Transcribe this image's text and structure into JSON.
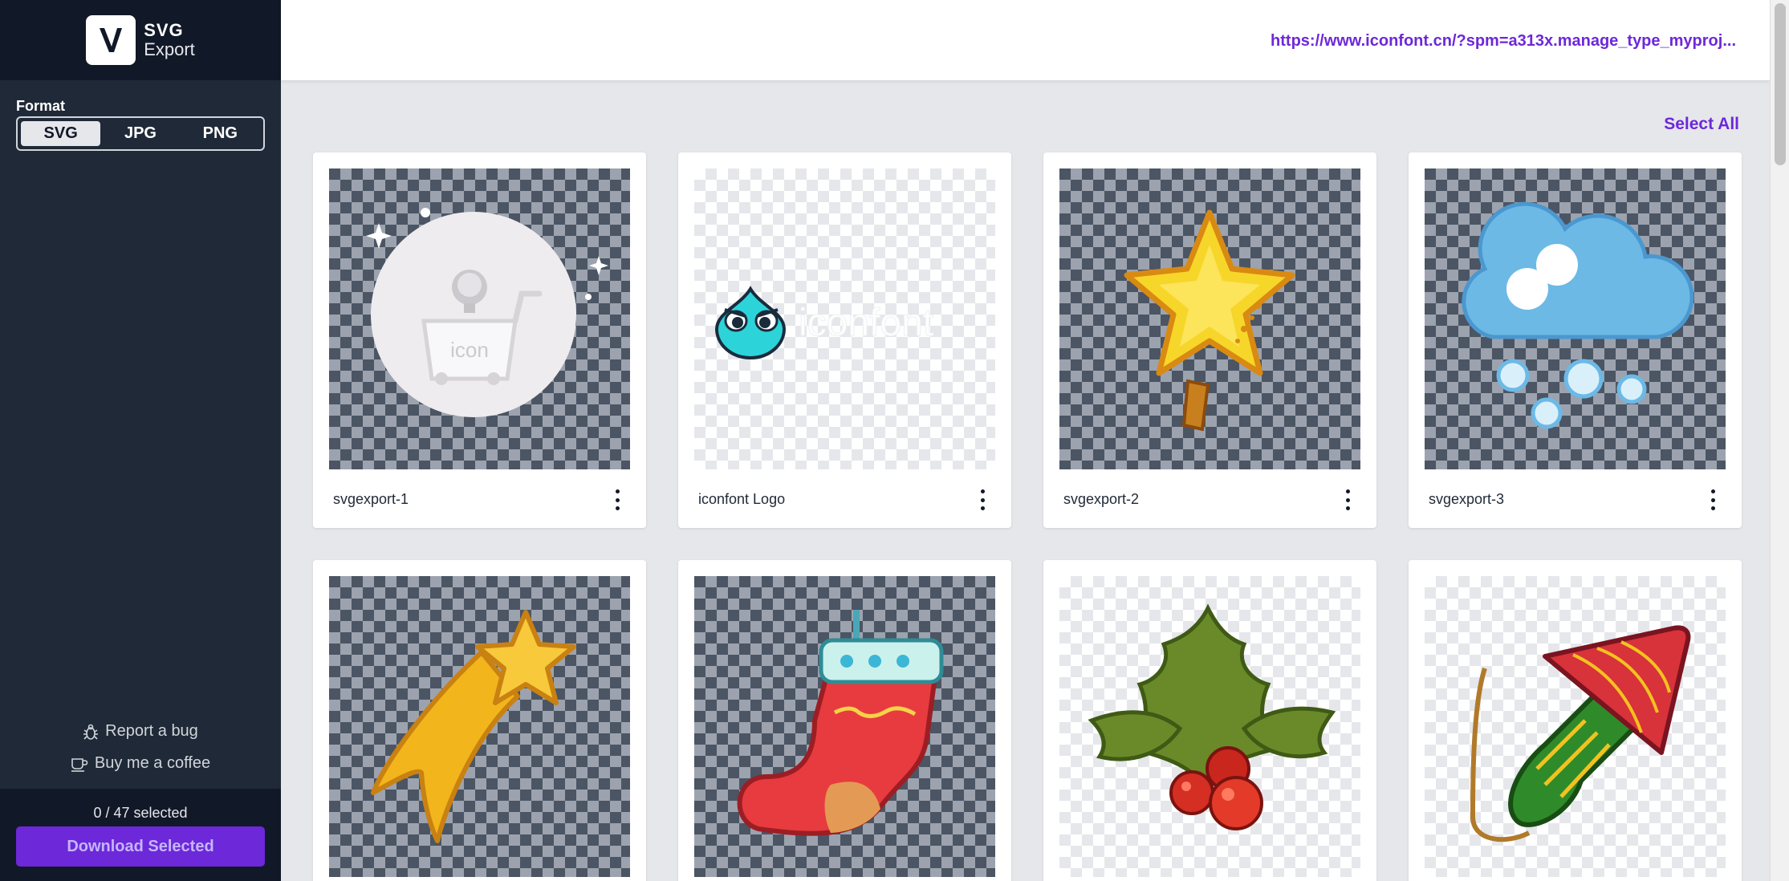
{
  "brand": {
    "line1": "SVG",
    "line2": "Export",
    "logo_letter": "V"
  },
  "sidebar": {
    "format_label": "Format",
    "formats": [
      "SVG",
      "JPG",
      "PNG"
    ],
    "active_format": "SVG",
    "report_bug": "Report a bug",
    "buy_coffee": "Buy me a coffee",
    "selected_count": "0 / 47 selected",
    "download_label": "Download Selected"
  },
  "header": {
    "url": "https://www.iconfont.cn/?spm=a313x.manage_type_myproj..."
  },
  "main": {
    "select_all": "Select All",
    "icons": [
      {
        "name": "svgexport-1",
        "icon": "shopping-cart-placeholder-icon",
        "bg": "dark"
      },
      {
        "name": "iconfont Logo",
        "icon": "iconfont-logo-icon",
        "bg": "light"
      },
      {
        "name": "svgexport-2",
        "icon": "star-tree-topper-icon",
        "bg": "dark"
      },
      {
        "name": "svgexport-3",
        "icon": "snow-cloud-icon",
        "bg": "dark"
      },
      {
        "name": "",
        "icon": "shooting-star-icon",
        "bg": "dark"
      },
      {
        "name": "",
        "icon": "christmas-stocking-icon",
        "bg": "dark"
      },
      {
        "name": "",
        "icon": "holly-berries-icon",
        "bg": "light"
      },
      {
        "name": "",
        "icon": "firework-rocket-icon",
        "bg": "light"
      }
    ]
  },
  "colors": {
    "accent": "#6d28d9",
    "sidebar_bg": "#1f2937",
    "sidebar_dark": "#111827"
  }
}
